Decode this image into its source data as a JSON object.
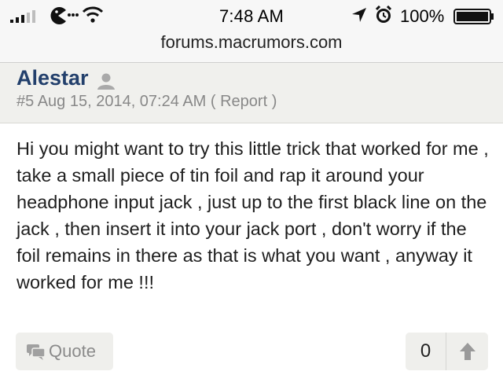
{
  "status_bar": {
    "time": "7:48 AM",
    "battery_percent": "100%",
    "signal_icon": "signal-bars-icon",
    "carrier_icon": "pacman-carrier-icon",
    "wifi_icon": "wifi-icon",
    "location_icon": "location-arrow-icon",
    "alarm_icon": "alarm-clock-icon",
    "battery_icon": "battery-icon"
  },
  "address_bar": {
    "url": "forums.macrumors.com"
  },
  "post": {
    "author": "Alestar",
    "author_icon": "user-silhouette-icon",
    "number": "#5",
    "date": "Aug 15, 2014, 07:24 AM",
    "report_open": "(",
    "report_label": "Report",
    "report_close": ")",
    "body": "Hi you might want to try this little trick that worked for me , take a small piece of tin foil and rap it around your headphone input jack , just up to the first black line on the jack , then insert it into your jack port , don't worry if the foil remains in there as that is what you want , anyway it worked for me !!!",
    "quote_label": "Quote",
    "quote_icon": "speech-bubble-icon",
    "like_count": "0",
    "upvote_icon": "arrow-up-icon"
  },
  "colors": {
    "username": "#23406c",
    "meta_text": "#888888",
    "header_bg": "#f0f0ed",
    "button_bg": "#efefec"
  }
}
